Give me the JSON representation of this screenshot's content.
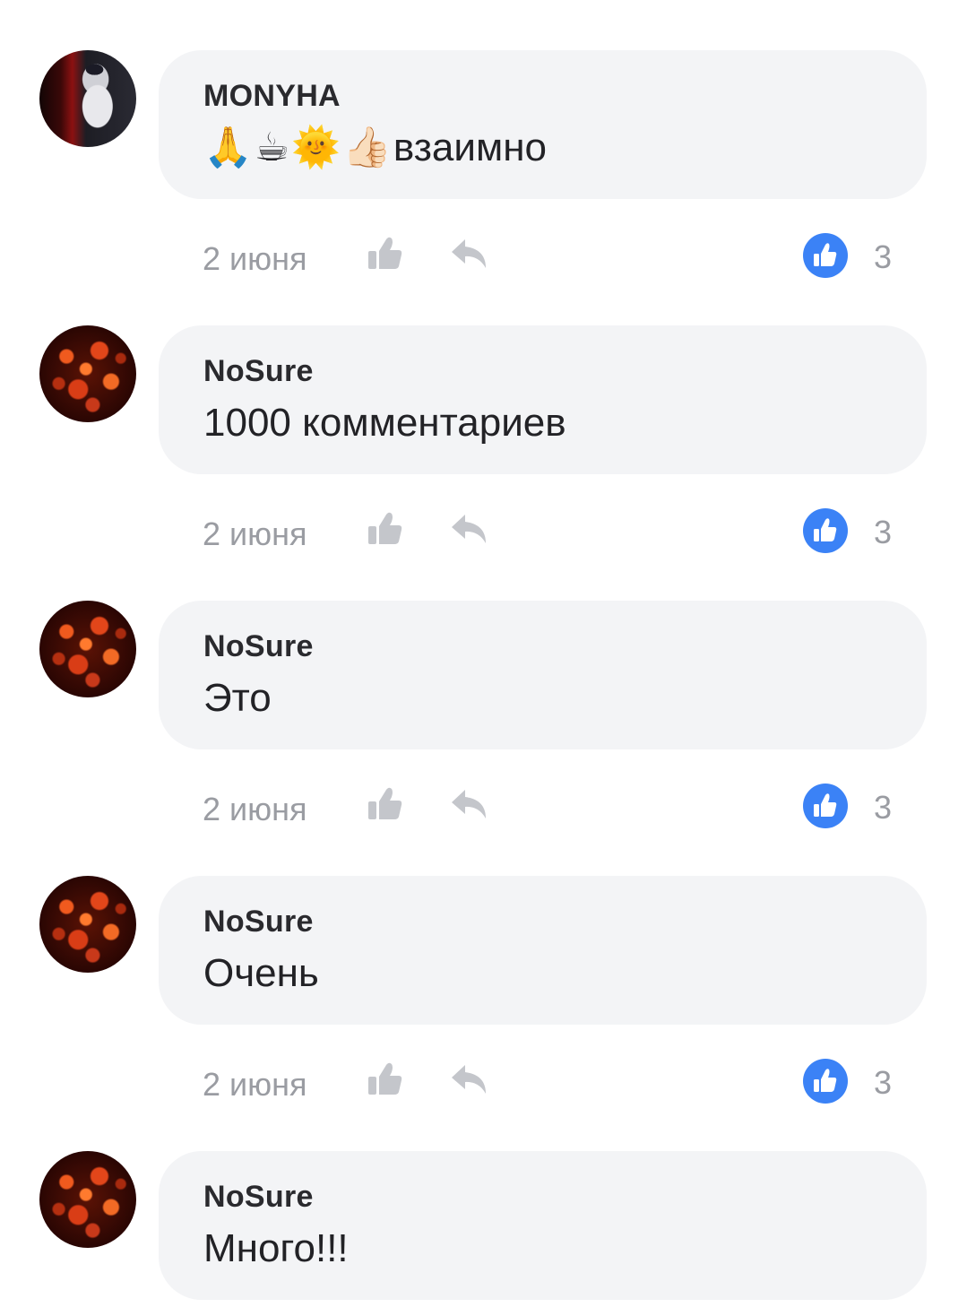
{
  "colors": {
    "bubble_bg": "#f3f4f6",
    "meta_text": "#9a9ca2",
    "like_badge": "#3b82f6",
    "icon_gray": "#c4c6cb"
  },
  "comments": [
    {
      "author": "MONYHA",
      "emojis": [
        "🙏",
        "☕",
        "🌞",
        "👍🏻"
      ],
      "text": "взаимно",
      "date": "2 июня",
      "likes": "3"
    },
    {
      "author": "NoSure",
      "text": "1000 комментариев",
      "date": "2 июня",
      "likes": "3"
    },
    {
      "author": "NoSure",
      "text": "Это",
      "date": "2 июня",
      "likes": "3"
    },
    {
      "author": "NoSure",
      "text": "Очень",
      "date": "2 июня",
      "likes": "3"
    },
    {
      "author": "NoSure",
      "text": "Много!!!",
      "date": "",
      "likes": ""
    }
  ]
}
